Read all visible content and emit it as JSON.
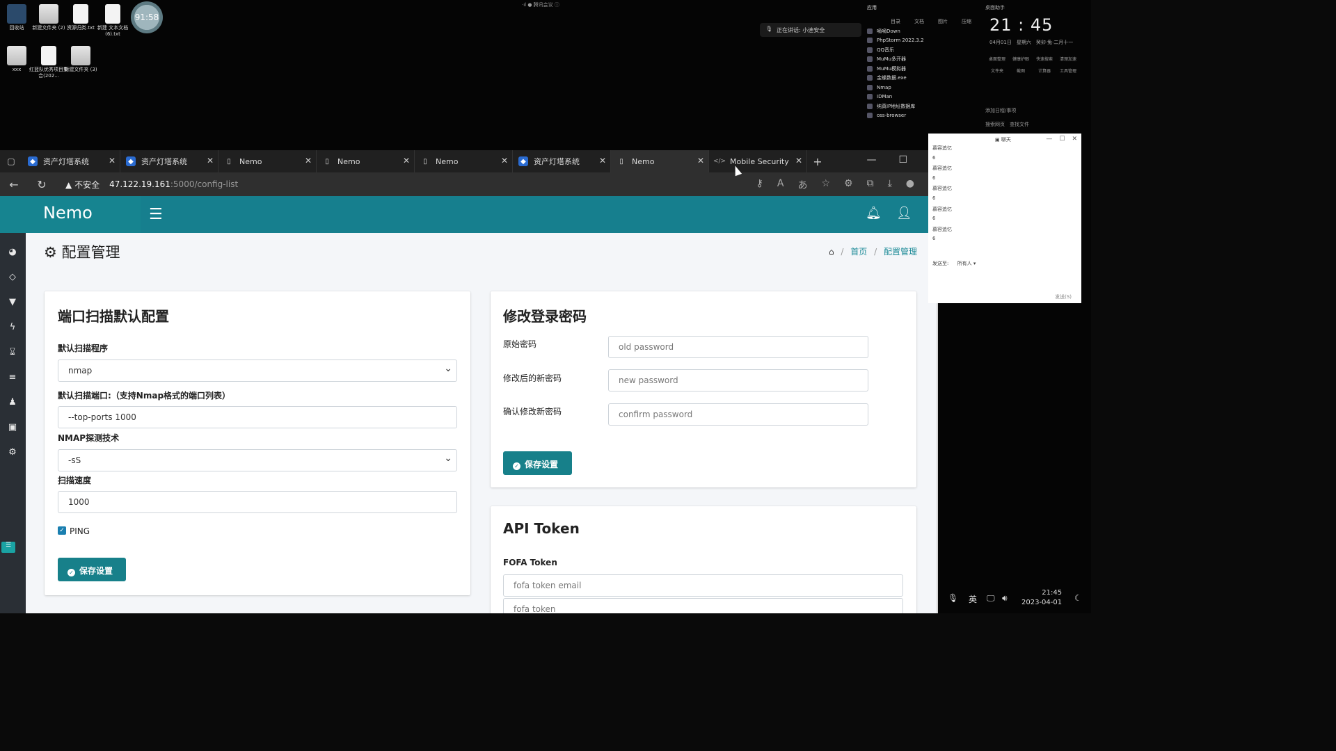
{
  "desktop": {
    "icons": [
      {
        "label": "回收站"
      },
      {
        "label": "新建文件夹 (2)"
      },
      {
        "label": "资源归类.txt"
      },
      {
        "label": "新建 文本文档 (6).txt"
      },
      {
        "label": "xxx"
      },
      {
        "label": "红蓝队优秀项目集合(202..."
      },
      {
        "label": "新建文件夹 (3)"
      }
    ],
    "timer": "91:58",
    "top_center_text": "·ıl ● 腾讯会议 ⓘ",
    "voice_pill": "正在讲话: 小迪安全",
    "apps_panel": {
      "header": "应用",
      "tabs": [
        "目录",
        "文档",
        "图片",
        "压缩"
      ],
      "apps": [
        "嘀嘀Down",
        "PhpStorm 2022.3.2",
        "QQ音乐",
        "MuMu多开器",
        "MuMu模拟器",
        "金蝶数据.exe",
        "Nmap",
        "IDMan",
        "纯真IP地址数据库",
        "oss-browser"
      ]
    },
    "clock_panel": {
      "label": "桌面助手",
      "time": "21 : 45",
      "date": "04月01日　星期六　癸卯·兔·二月十一",
      "shortcuts": [
        "桌面整理",
        "健康护眼",
        "快速搜索",
        "清理加速",
        "文件夹",
        "截图",
        "计算器",
        "工具管理"
      ],
      "footer1": "添加日程/事项",
      "footer2": "搜索网页　查找文件"
    }
  },
  "browser": {
    "tabs": [
      {
        "label": "资产灯塔系统",
        "icon": "shield"
      },
      {
        "label": "资产灯塔系统",
        "icon": "shield"
      },
      {
        "label": "Nemo",
        "icon": "doc"
      },
      {
        "label": "Nemo",
        "icon": "doc"
      },
      {
        "label": "Nemo",
        "icon": "doc"
      },
      {
        "label": "资产灯塔系统",
        "icon": "shield"
      },
      {
        "label": "Nemo",
        "icon": "doc"
      },
      {
        "label": "Mobile Security",
        "icon": "code"
      }
    ],
    "new_tab": "+",
    "security_warning": "不安全",
    "url_host": "47.122.19.161",
    "url_path": ":5000/config-list"
  },
  "app": {
    "brand": "Nemo",
    "page_title": "配置管理",
    "breadcrumb": {
      "home": "首页",
      "current": "配置管理"
    },
    "port_scan": {
      "title": "端口扫描默认配置",
      "program_label": "默认扫描程序",
      "program_value": "nmap",
      "ports_label": "默认扫描端口:（支持Nmap格式的端口列表）",
      "ports_value": "--top-ports 1000",
      "tech_label": "NMAP探测技术",
      "tech_value": "-sS",
      "speed_label": "扫描速度",
      "speed_value": "1000",
      "ping_label": "PING",
      "ping_checked": true,
      "save": "保存设置"
    },
    "password": {
      "title": "修改登录密码",
      "old_label": "原始密码",
      "old_placeholder": "old password",
      "new_label": "修改后的新密码",
      "new_placeholder": "new password",
      "confirm_label": "确认修改新密码",
      "confirm_placeholder": "confirm password",
      "save": "保存设置"
    },
    "api": {
      "title": "API Token",
      "fofa_label": "FOFA Token",
      "fofa_email_placeholder": "fofa token email",
      "fofa_token_placeholder": "fofa token"
    }
  },
  "chat": {
    "title": "聊天",
    "messages": [
      {
        "sender": "慕容追忆",
        "text": "6"
      },
      {
        "sender": "慕容追忆",
        "text": "6"
      },
      {
        "sender": "慕容追忆",
        "text": "6"
      },
      {
        "sender": "慕容追忆",
        "text": "6"
      },
      {
        "sender": "慕容追忆",
        "text": "6"
      }
    ],
    "send_to_label": "发送至:",
    "send_to_value": "所有人 ▾",
    "send": "发送(S)"
  },
  "taskbar": {
    "ime": "英",
    "time": "21:45",
    "date": "2023-04-01"
  },
  "colors": {
    "teal": "#167f8e",
    "sidebar": "#2a2f35",
    "page_bg": "#f4f6f9"
  }
}
